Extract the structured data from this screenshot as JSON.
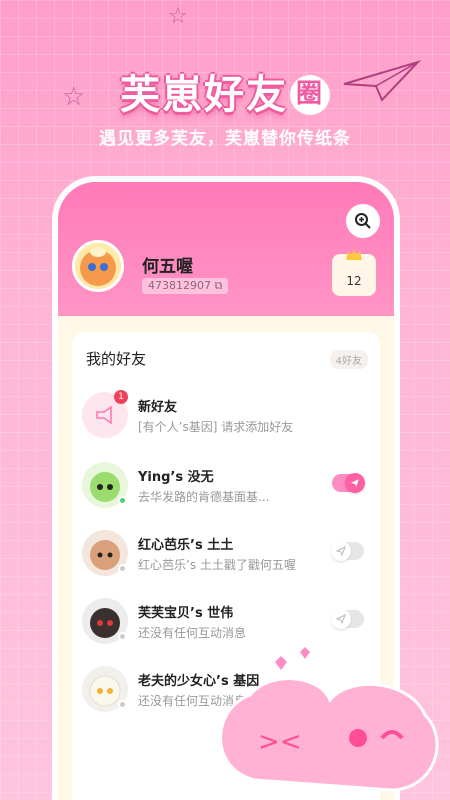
{
  "hero": {
    "title": "芙崽好友",
    "title_circle": "圈",
    "subtitle": "遇见更多芙友，芙崽替你传纸条"
  },
  "profile": {
    "name": "何五喔",
    "id": "473812907",
    "rank": "12"
  },
  "friends": {
    "title": "我的好友",
    "count": "4好友",
    "items": [
      {
        "name": "新好友",
        "message": "[有个人’s基因] 请求添加好友",
        "badge": "1",
        "online": null,
        "toggle": null,
        "avatar_color": "#ffe6ee"
      },
      {
        "name": "Ying’s 没无",
        "message": "去华发路的肯德基面基...",
        "online": true,
        "toggle": "on",
        "avatar_color": "#9bdc6e"
      },
      {
        "name": "红心芭乐’s 土土",
        "message": "红心芭乐’s 土土戳了戳何五喔",
        "online": false,
        "toggle": "off",
        "avatar_color": "#d9a07a"
      },
      {
        "name": "芙芙宝贝’s 世伟",
        "message": "还没有任何互动消息",
        "online": false,
        "toggle": "off",
        "avatar_color": "#3a3030"
      },
      {
        "name": "老夫的少女心’s 基因",
        "message": "还没有任何互动消息",
        "online": false,
        "toggle": null,
        "avatar_color": "#f3efe6"
      }
    ]
  },
  "colors": {
    "accent": "#ff5fa3",
    "background": "#ffb6d6",
    "online": "#4cd07a",
    "offline": "#cccccc"
  }
}
